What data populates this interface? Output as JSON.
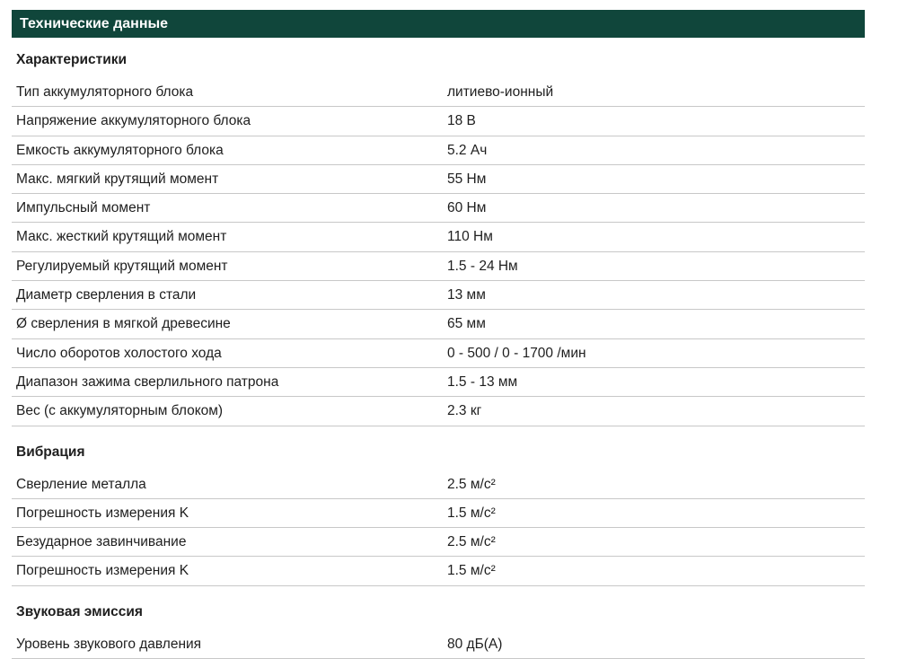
{
  "header": {
    "title": "Технические данные"
  },
  "sections": [
    {
      "title": "Характеристики",
      "rows": [
        {
          "label": "Тип аккумуляторного блока",
          "value": "литиево-ионный"
        },
        {
          "label": "Напряжение аккумуляторного блока",
          "value": "18 В"
        },
        {
          "label": "Емкость аккумуляторного блока",
          "value": "5.2 Ач"
        },
        {
          "label": "Макс. мягкий крутящий момент",
          "value": "55 Нм"
        },
        {
          "label": "Импульсный момент",
          "value": "60 Нм"
        },
        {
          "label": "Макс. жесткий крутящий момент",
          "value": "110 Нм"
        },
        {
          "label": "Регулируемый крутящий момент",
          "value": "1.5 - 24 Нм"
        },
        {
          "label": "Диаметр сверления в стали",
          "value": "13 мм"
        },
        {
          "label": "Ø сверления в мягкой древесине",
          "value": "65 мм"
        },
        {
          "label": "Число оборотов холостого хода",
          "value": "0 - 500 / 0 - 1700 /мин"
        },
        {
          "label": "Диапазон зажима сверлильного патрона",
          "value": "1.5 - 13 мм"
        },
        {
          "label": "Вес (с аккумуляторным блоком)",
          "value": "2.3 кг"
        }
      ]
    },
    {
      "title": "Вибрация",
      "rows": [
        {
          "label": "Сверление металла",
          "value": "2.5 м/с²"
        },
        {
          "label": "Погрешность измерения K",
          "value": "1.5 м/с²"
        },
        {
          "label": "Безударное завинчивание",
          "value": "2.5 м/с²"
        },
        {
          "label": "Погрешность измерения K",
          "value": "1.5 м/с²"
        }
      ]
    },
    {
      "title": "Звуковая эмиссия",
      "rows": [
        {
          "label": "Уровень звукового давления",
          "value": "80 дБ(A)"
        }
      ]
    }
  ],
  "colors": {
    "header_bg": "#10463b",
    "header_text": "#ffffff",
    "row_divider": "#c8c8c8",
    "text": "#1e1e1e"
  }
}
